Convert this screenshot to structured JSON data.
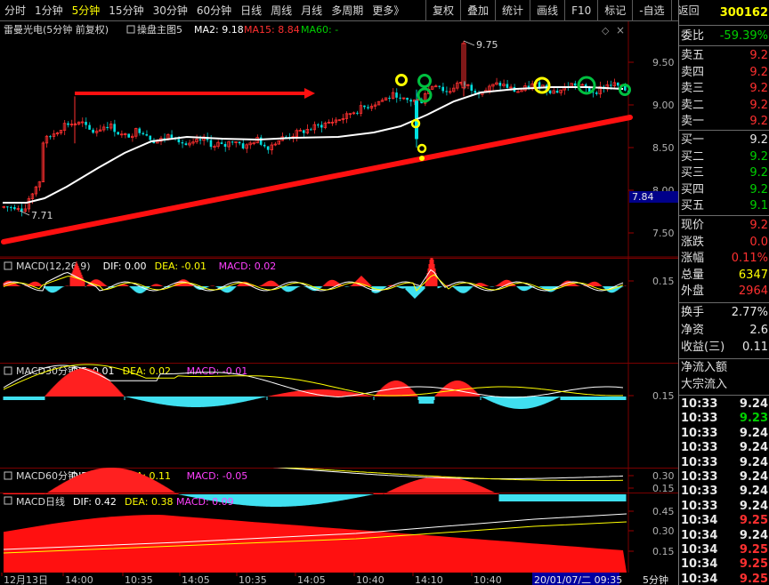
{
  "toolbar": {
    "periods": [
      "分时",
      "1分钟",
      "5分钟",
      "15分钟",
      "30分钟",
      "60分钟",
      "日线",
      "周线",
      "月线",
      "多周期",
      "更多》"
    ],
    "active_period": "5分钟",
    "tools": [
      "复权",
      "叠加",
      "统计",
      "画线",
      "F10",
      "标记",
      "-自选",
      "返回"
    ]
  },
  "main_chart": {
    "stock_name": "雷曼光电(5分钟 前复权)",
    "indicator_name": "操盘主图5",
    "ma2": "MA2: 9.18",
    "ma15": "MA15: 8.84",
    "ma60": "MA60: -",
    "y_ticks": [
      "9.50",
      "9.00",
      "8.50",
      "8.00",
      "7.50"
    ],
    "high_label": "9.75",
    "low_label": "7.71",
    "price_tag": "7.84"
  },
  "macd_panels": [
    {
      "title": "MACD(12,26,9)",
      "dif": "DIF: 0.00",
      "dea": "DEA: -0.01",
      "macd": "MACD: 0.02",
      "ticks": [
        "0.15"
      ]
    },
    {
      "title": "MACD30分钟",
      "dif": "DIF: 0.01",
      "dea": "DEA: 0.02",
      "macd": "MACD: -0.01",
      "ticks": [
        "0.15"
      ]
    },
    {
      "title": "MACD60分钟",
      "dif": "DIF: 0.08",
      "dea": "DEA: 0.11",
      "macd": "MACD: -0.05",
      "ticks": [
        "0.30",
        "0.15"
      ]
    },
    {
      "title": "MACD日线",
      "dif": "DIF: 0.42",
      "dea": "DEA: 0.38",
      "macd": "MACD: 0.09",
      "ticks": [
        "0.45",
        "0.30",
        "0.15"
      ]
    }
  ],
  "time_axis": {
    "labels": [
      "12月13日",
      "14:00",
      "10:35",
      "14:05",
      "10:35",
      "14:05",
      "10:40",
      "14:10",
      "10:40"
    ],
    "highlight": "20/01/07/二 09:35",
    "period": "5分钟"
  },
  "quote_panel": {
    "code": "300162",
    "webi_label": "委比",
    "webi_value": "-59.39%",
    "sell": [
      {
        "label": "卖五",
        "value": "9.2"
      },
      {
        "label": "卖四",
        "value": "9.2"
      },
      {
        "label": "卖三",
        "value": "9.2"
      },
      {
        "label": "卖二",
        "value": "9.2"
      },
      {
        "label": "卖一",
        "value": "9.2"
      }
    ],
    "buy": [
      {
        "label": "买一",
        "value": "9.2",
        "color": "#e8e8e8"
      },
      {
        "label": "买二",
        "value": "9.2",
        "color": "#00d000"
      },
      {
        "label": "买三",
        "value": "9.2",
        "color": "#00d000"
      },
      {
        "label": "买四",
        "value": "9.2",
        "color": "#00d000"
      },
      {
        "label": "买五",
        "value": "9.1",
        "color": "#00d000"
      }
    ],
    "stats": [
      {
        "label": "现价",
        "value": "9.2",
        "color": "#ff3030"
      },
      {
        "label": "涨跌",
        "value": "0.0",
        "color": "#ff3030"
      },
      {
        "label": "涨幅",
        "value": "0.11%",
        "color": "#ff3030"
      },
      {
        "label": "总量",
        "value": "6347",
        "color": "#ffff00"
      },
      {
        "label": "外盘",
        "value": "2964",
        "color": "#ff3030"
      }
    ],
    "stats2": [
      {
        "label": "换手",
        "value": "2.77%",
        "color": "#e8e8e8"
      },
      {
        "label": "净资",
        "value": "2.6",
        "color": "#e8e8e8"
      },
      {
        "label": "收益(三)",
        "value": "0.11",
        "color": "#e8e8e8"
      }
    ],
    "flow_labels": [
      "净流入额",
      "大宗流入"
    ],
    "ticks": [
      {
        "time": "10:33",
        "price": "9.24",
        "color": "#e8e8e8"
      },
      {
        "time": "10:33",
        "price": "9.23",
        "color": "#00d000"
      },
      {
        "time": "10:33",
        "price": "9.24",
        "color": "#e8e8e8"
      },
      {
        "time": "10:33",
        "price": "9.24",
        "color": "#e8e8e8"
      },
      {
        "time": "10:33",
        "price": "9.24",
        "color": "#e8e8e8"
      },
      {
        "time": "10:33",
        "price": "9.24",
        "color": "#e8e8e8"
      },
      {
        "time": "10:33",
        "price": "9.24",
        "color": "#e8e8e8"
      },
      {
        "time": "10:33",
        "price": "9.24",
        "color": "#e8e8e8"
      },
      {
        "time": "10:34",
        "price": "9.25",
        "color": "#ff3030"
      },
      {
        "time": "10:34",
        "price": "9.24",
        "color": "#e8e8e8"
      },
      {
        "time": "10:34",
        "price": "9.25",
        "color": "#ff3030"
      },
      {
        "time": "10:34",
        "price": "9.25",
        "color": "#ff3030"
      },
      {
        "time": "10:34",
        "price": "9.25",
        "color": "#ff3030"
      }
    ]
  }
}
